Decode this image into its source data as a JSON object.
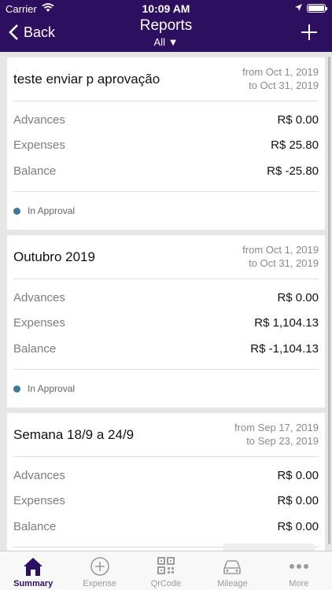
{
  "status_bar": {
    "carrier": "Carrier",
    "time": "10:09 AM"
  },
  "nav": {
    "back_label": "Back",
    "title": "Reports",
    "filter": "All ▼"
  },
  "reports": [
    {
      "title": "teste enviar p aprovação",
      "date_from": "from Oct 1, 2019",
      "date_to": "to Oct 31, 2019",
      "advances_label": "Advances",
      "advances": "R$ 0.00",
      "expenses_label": "Expenses",
      "expenses": "R$ 25.80",
      "balance_label": "Balance",
      "balance": "R$ -25.80",
      "status": "In Approval"
    },
    {
      "title": "Outubro 2019",
      "date_from": "from Oct 1, 2019",
      "date_to": "to Oct 31, 2019",
      "advances_label": "Advances",
      "advances": "R$ 0.00",
      "expenses_label": "Expenses",
      "expenses": "R$ 1,104.13",
      "balance_label": "Balance",
      "balance": "R$ -1,104.13",
      "status": "In Approval"
    },
    {
      "title": "Semana 18/9 a 24/9",
      "date_from": "from Sep 17, 2019",
      "date_to": "to Sep 23, 2019",
      "advances_label": "Advances",
      "advances": "R$ 0.00",
      "expenses_label": "Expenses",
      "expenses": "R$ 0.00",
      "balance_label": "Balance",
      "balance": "R$ 0.00"
    }
  ],
  "tabs": [
    {
      "label": "Summary",
      "icon": "home-icon"
    },
    {
      "label": "Expense",
      "icon": "plus-circle-icon"
    },
    {
      "label": "QrCode",
      "icon": "qr-code-icon"
    },
    {
      "label": "Mileage",
      "icon": "car-icon"
    },
    {
      "label": "More",
      "icon": "more-dots-icon"
    }
  ],
  "colors": {
    "brand": "#2c0f5e",
    "status_dot": "#3e7a93"
  }
}
